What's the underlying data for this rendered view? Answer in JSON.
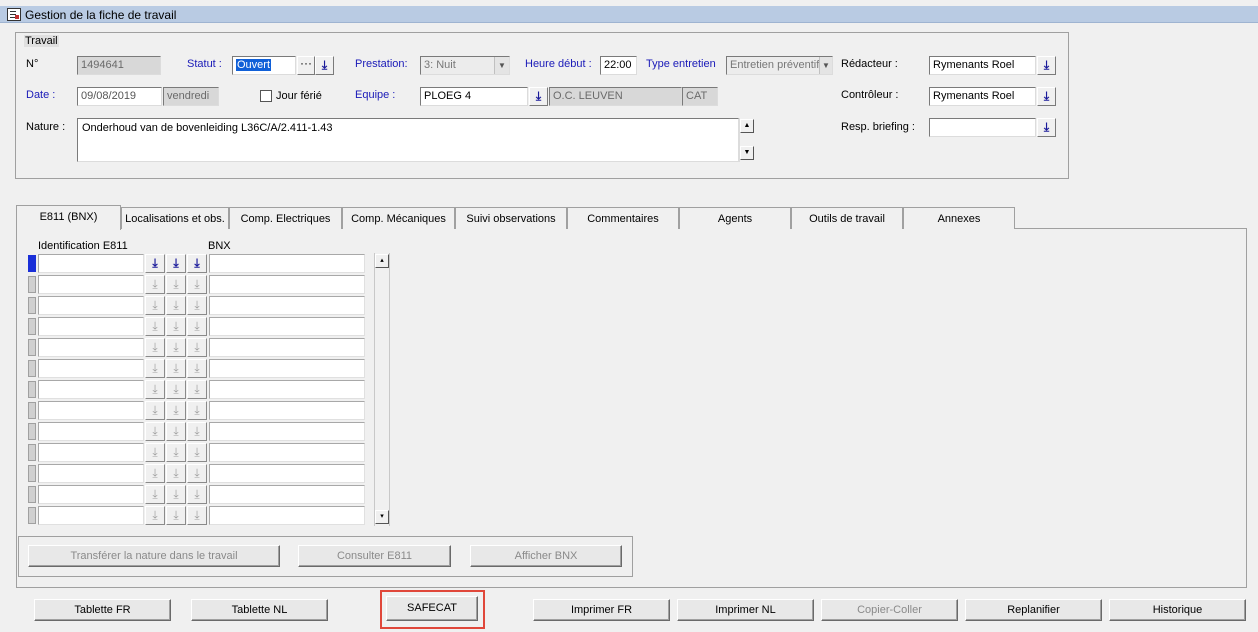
{
  "window": {
    "title": "Gestion de la fiche de travail"
  },
  "travail": {
    "group_label": "Travail",
    "numero_label": "N°",
    "numero_value": "1494641",
    "statut_label": "Statut :",
    "statut_value": "Ouvert",
    "statut_more": "···",
    "prestation_label": "Prestation:",
    "prestation_value": "3: Nuit",
    "heure_debut_label": "Heure début :",
    "heure_debut_value": "22:00",
    "type_entretien_label": "Type entretien",
    "type_entretien_value": "Entretien préventif",
    "redacteur_label": "Rédacteur :",
    "redacteur_value": "Rymenants Roel",
    "date_label": "Date :",
    "date_value": "09/08/2019",
    "jour_value": "vendredi",
    "jour_ferie_label": "Jour férié",
    "equipe_label": "Equipe :",
    "equipe_value": "PLOEG 4",
    "equipe_oc": "O.C. LEUVEN",
    "equipe_cat": "CAT",
    "controleur_label": "Contrôleur :",
    "controleur_value": "Rymenants Roel",
    "nature_label": "Nature :",
    "nature_value": "Onderhoud van de bovenleiding  L36C/A/2.411-1.43",
    "resp_briefing_label": "Resp. briefing :",
    "resp_briefing_value": ""
  },
  "tabs": [
    {
      "label": "E811 (BNX)",
      "active": true
    },
    {
      "label": "Localisations et obs.",
      "active": false
    },
    {
      "label": "Comp. Electriques",
      "active": false
    },
    {
      "label": "Comp. Mécaniques",
      "active": false
    },
    {
      "label": "Suivi observations",
      "active": false
    },
    {
      "label": "Commentaires",
      "active": false
    },
    {
      "label": "Agents",
      "active": false
    },
    {
      "label": "Outils de travail",
      "active": false
    },
    {
      "label": "Annexes",
      "active": false
    }
  ],
  "e811": {
    "col_identification": "Identification E811",
    "col_bnx": "BNX",
    "rows": 13,
    "buttons": {
      "transferer": "Transférer la nature dans le travail",
      "consulter": "Consulter E811",
      "afficher": "Afficher BNX"
    }
  },
  "footer": {
    "tablette_fr": "Tablette FR",
    "tablette_nl": "Tablette NL",
    "safecat": "SAFECAT",
    "imprimer_fr": "Imprimer FR",
    "imprimer_nl": "Imprimer NL",
    "copier_coller": "Copier-Coller",
    "replanifier": "Replanifier",
    "historique": "Historique"
  },
  "icons": {
    "dropdown": "download-arrow-icon",
    "window": "form-window-icon"
  },
  "colors": {
    "titlebar": "#b9cbe3",
    "link_label": "#1a1ab8",
    "selection": "#1060d8",
    "highlight": "#e0473a"
  }
}
